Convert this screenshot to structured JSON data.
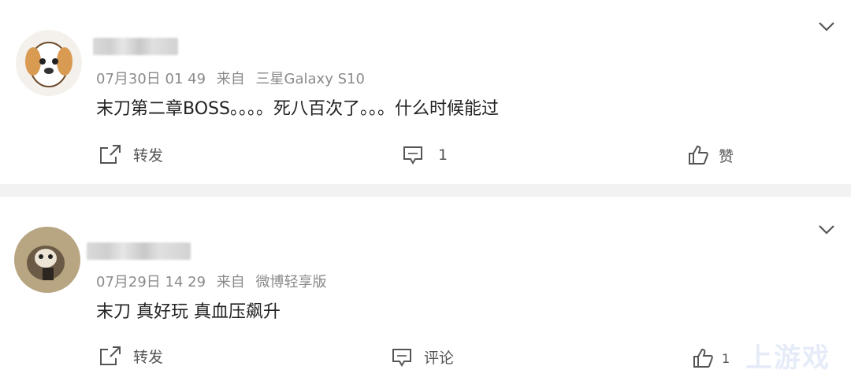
{
  "posts": [
    {
      "time": "07月30日 01 49",
      "source_prefix": "来自",
      "source": "三星Galaxy S10",
      "content": "末刀第二章BOSS。。。。死八百次了。。。什么时候能过",
      "actions": {
        "repost": "转发",
        "comment": "1",
        "like": "赞"
      }
    },
    {
      "time": "07月29日 14 29",
      "source_prefix": "来自",
      "source": "微博轻享版",
      "content": "末刀 真好玩 真血压飙升",
      "actions": {
        "repost": "转发",
        "comment": "评论",
        "like": "1"
      }
    }
  ],
  "watermark": "上游戏"
}
